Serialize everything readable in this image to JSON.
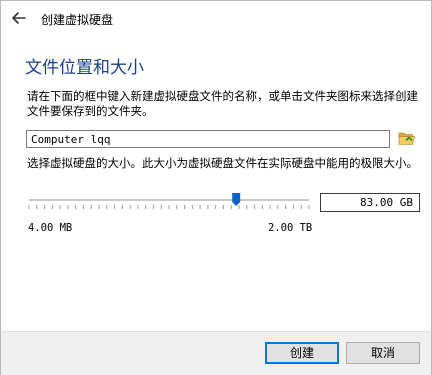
{
  "window": {
    "title": "创建虚拟硬盘"
  },
  "section": {
    "heading": "文件位置和大小",
    "location_description": "请在下面的框中键入新建虚拟硬盘文件的名称，或单击文件夹图标来选择创建文件要保存到的文件夹。",
    "size_description": "选择虚拟硬盘的大小。此大小为虚拟硬盘文件在实际硬盘中能用的极限大小。"
  },
  "file_location": {
    "value": "Computer lqq"
  },
  "size": {
    "value": "83.00 GB",
    "slider_fraction": 0.74,
    "min_label": "4.00 MB",
    "max_label": "2.00 TB"
  },
  "buttons": {
    "create_label": "创建",
    "cancel_label": "取消"
  },
  "colors": {
    "heading": "#1c3f8f",
    "slider_handle": "#0a64c8",
    "default_button_border": "#0078d7"
  },
  "icons": {
    "back": "arrow-left",
    "folder": "folder-open"
  }
}
